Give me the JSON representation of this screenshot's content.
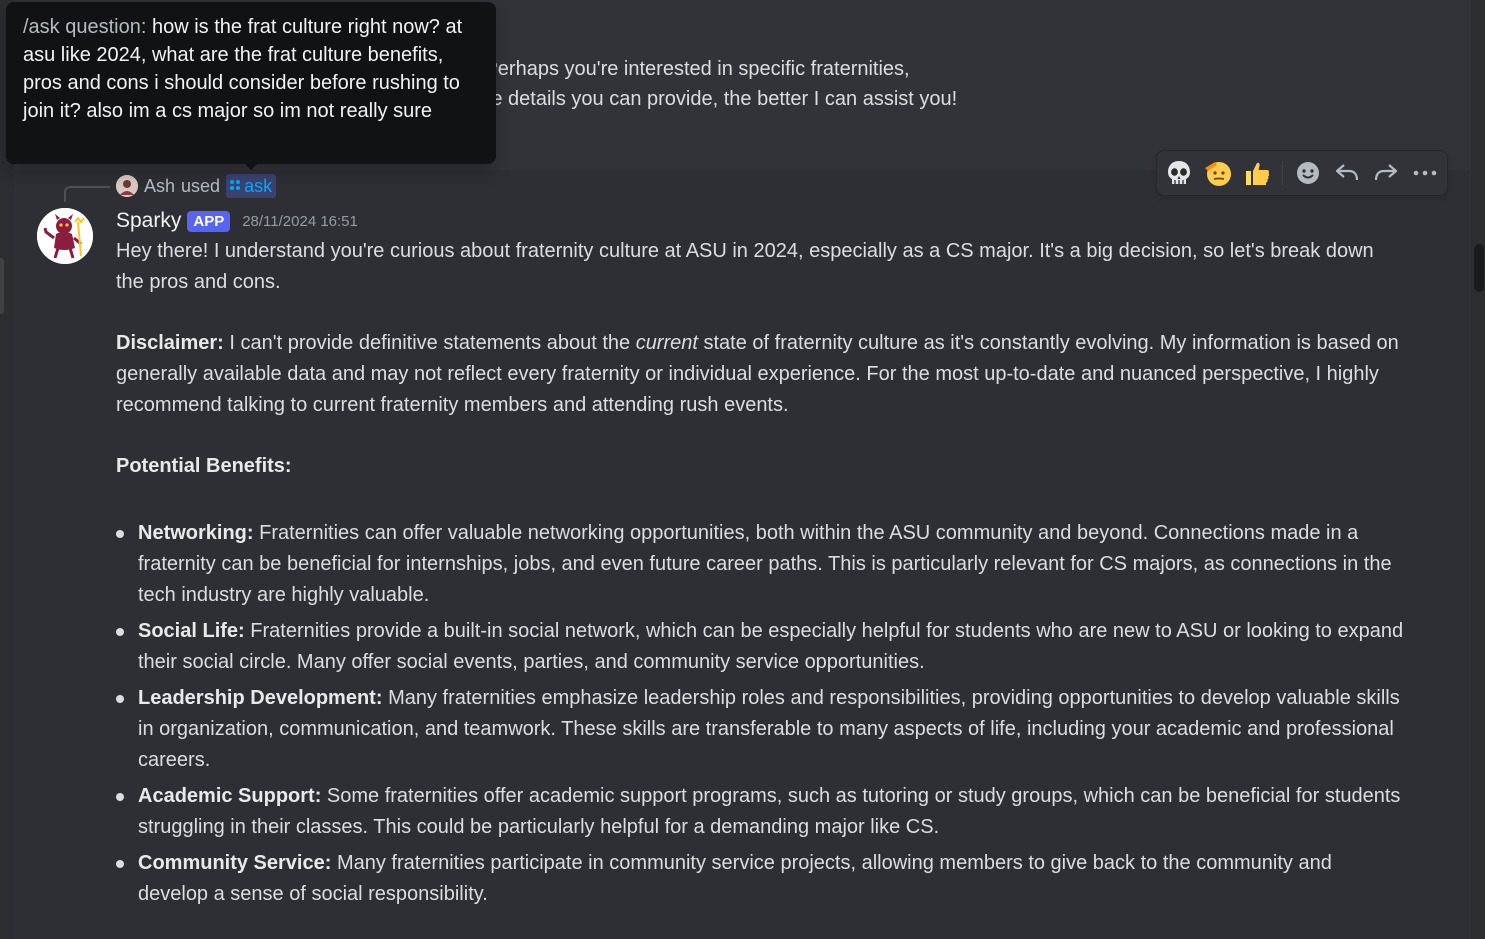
{
  "tooltip": {
    "prefix": "/ask question:",
    "question": "how is the frat culture right now? at asu like 2024, what are the frat culture benefits, pros and cons i should consider before rushing to join it? also im a cs major so im not really sure"
  },
  "previous_message": {
    "line1": "at culture you'd like to know more about?  Perhaps you're interested in specific fraternities,",
    "line2": "r the social aspects of Greek life?  The more details you can provide, the better I can assist you!"
  },
  "interaction": {
    "user": "Ash",
    "used_text": "used",
    "command": "ask"
  },
  "message": {
    "author": "Sparky",
    "badge": "APP",
    "timestamp": "28/11/2024 16:51",
    "intro": "Hey there!  I understand you're curious about fraternity culture at ASU in 2024, especially as a CS major.  It's a big decision, so let's break down the pros and cons.",
    "disclaimer_label": "Disclaimer:",
    "disclaimer_pre": " I can't provide definitive statements about the ",
    "disclaimer_em": "current",
    "disclaimer_post": " state of fraternity culture as it's constantly evolving. My information is based on generally available data and may not reflect every fraternity or individual experience.  For the most up-to-date and nuanced perspective, I highly recommend talking to current fraternity members and attending rush events.",
    "benefits_heading": "Potential Benefits:",
    "benefits": [
      {
        "title": "Networking:",
        "text": " Fraternities can offer valuable networking opportunities, both within the ASU community and beyond.  Connections made in a fraternity can be beneficial for internships, jobs, and even future career paths.  This is particularly relevant for CS majors, as connections in the tech industry are highly valuable."
      },
      {
        "title": "Social Life:",
        "text": " Fraternities provide a built-in social network, which can be especially helpful for students who are new to ASU or looking to expand their social circle.  Many offer social events, parties, and community service opportunities."
      },
      {
        "title": "Leadership Development:",
        "text": " Many fraternities emphasize leadership roles and responsibilities, providing opportunities to develop valuable skills in organization, communication, and teamwork.  These skills are transferable to many aspects of life, including your academic and professional careers."
      },
      {
        "title": "Academic Support:",
        "text": " Some fraternities offer academic support programs, such as tutoring or study groups, which can be beneficial for students struggling in their classes.  This could be particularly helpful for a demanding major like CS."
      },
      {
        "title": "Community Service:",
        "text": " Many fraternities participate in community service projects, allowing members to give back to the community and develop a sense of social responsibility."
      }
    ]
  },
  "toolbar": {
    "reactions": [
      "skull-emoji",
      "saluting-face-emoji",
      "thumbs-up-emoji"
    ],
    "actions": [
      "add-reaction-icon",
      "reply-icon",
      "forward-icon",
      "more-options-icon"
    ]
  },
  "colors": {
    "background": "#323339",
    "hover_background": "#2e2f35",
    "tooltip": "#111214",
    "app_badge": "#5865f2",
    "command_link": "#00a8fc"
  }
}
